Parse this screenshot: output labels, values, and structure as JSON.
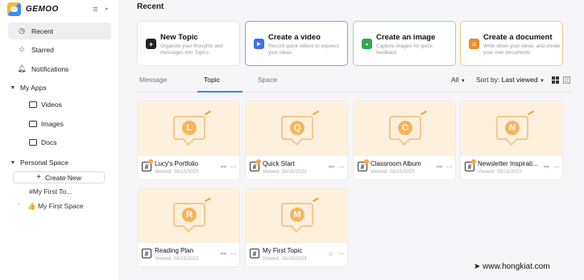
{
  "brand": {
    "name": "GEMOO"
  },
  "sidebar": {
    "recent": "Recent",
    "starred": "Starred",
    "notifications": "Notifications",
    "my_apps": {
      "label": "My Apps",
      "items": [
        "Videos",
        "Images",
        "Docs"
      ]
    },
    "personal_space": {
      "label": "Personal Space",
      "create_new": "Create New",
      "spaces": [
        "#My First To...",
        "👍 My First Space"
      ]
    }
  },
  "main": {
    "title": "Recent",
    "quick_cards": [
      {
        "title": "New Topic",
        "desc": "Organize your thoughts and messages into Topics",
        "color": "#222222"
      },
      {
        "title": "Create a video",
        "desc": "Record quick videos to express your ideas",
        "color": "#3b6ff0"
      },
      {
        "title": "Create an image",
        "desc": "Capture images for quick feedback",
        "color": "#2fa84f"
      },
      {
        "title": "Create a document",
        "desc": "Write down your ideas, and create your own documents",
        "color": "#f08a2b"
      }
    ],
    "tabs": [
      "Message",
      "Topic",
      "Space"
    ],
    "filter": {
      "all": "All",
      "sort_label": "Sort by:",
      "sort_value": "Last viewed"
    },
    "topics": [
      {
        "letter": "L",
        "name": "Lucy's Portfolio",
        "date": "Viewed: 03/15/2023"
      },
      {
        "letter": "Q",
        "name": "Quick Start",
        "date": "Viewed: 03/15/2023"
      },
      {
        "letter": "C",
        "name": "Classroom Album",
        "date": "Viewed: 03/15/2023"
      },
      {
        "letter": "N",
        "name": "Newsletter Inspirati...",
        "date": "Viewed: 03/15/2023"
      },
      {
        "letter": "R",
        "name": "Reading Plan",
        "date": "Viewed: 03/15/2023"
      },
      {
        "letter": "M",
        "name": "My First Topic",
        "date": "Viewed: 03/15/2023"
      }
    ]
  },
  "watermark": "www.hongkiat.com"
}
